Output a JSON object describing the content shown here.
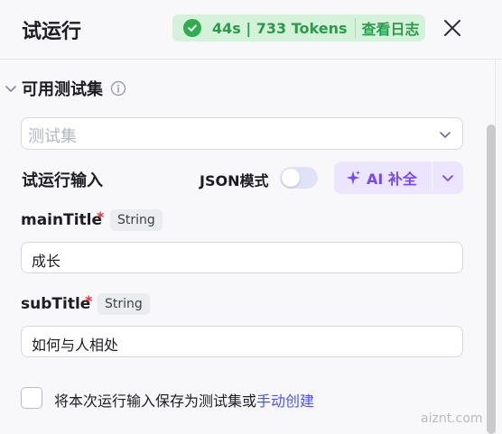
{
  "header": {
    "title": "试运行",
    "status": "44s | 733 Tokens",
    "view_log": "查看日志"
  },
  "testset": {
    "section_title": "可用测试集",
    "placeholder": "测试集"
  },
  "trial_input": {
    "label": "试运行输入",
    "json_mode_label": "JSON模式",
    "json_mode_on": false,
    "ai_button": "AI 补全"
  },
  "params": [
    {
      "name": "mainTitle",
      "required_mark": "*",
      "type": "String",
      "value": "成长"
    },
    {
      "name": "subTitle",
      "required_mark": "*",
      "type": "String",
      "value": "如何与人相处"
    }
  ],
  "footer": {
    "save_text": "将本次运行输入保存为测试集或",
    "create_link": "手动创建",
    "checked": false
  },
  "watermark": "aiznt.com",
  "colors": {
    "status_bg": "#d4f2d9",
    "status_text": "#2b9a4a",
    "ai_bg": "#ebe6fd",
    "ai_text": "#7748f5",
    "link": "#4d53e8",
    "required": "#e53535"
  }
}
